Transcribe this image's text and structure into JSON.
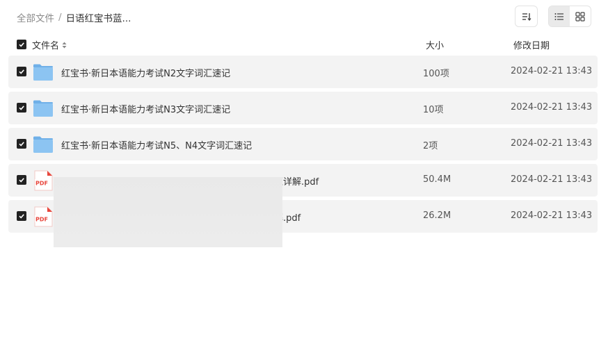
{
  "breadcrumb": {
    "root": "全部文件",
    "separator": "/",
    "current": "日语红宝书蓝..."
  },
  "toolbar": {
    "sort_icon": "sort-icon",
    "list_view_icon": "list-view-icon",
    "grid_view_icon": "grid-view-icon",
    "active_view": "list"
  },
  "table": {
    "headers": {
      "name": "文件名",
      "size": "大小",
      "date": "修改日期"
    },
    "rows": [
      {
        "type": "folder",
        "checked": true,
        "name": "红宝书·新日本语能力考试N2文字词汇速记",
        "size": "100项",
        "date": "2024-02-21 13:43"
      },
      {
        "type": "folder",
        "checked": true,
        "name": "红宝书·新日本语能力考试N3文字词汇速记",
        "size": "10项",
        "date": "2024-02-21 13:43"
      },
      {
        "type": "folder",
        "checked": true,
        "name": "红宝书·新日本语能力考试N5、N4文字词汇速记",
        "size": "2项",
        "date": "2024-02-21 13:43"
      },
      {
        "type": "pdf",
        "checked": true,
        "name": "汇详解.pdf",
        "size": "50.4M",
        "date": "2024-02-21 13:43"
      },
      {
        "type": "pdf",
        "checked": true,
        "name": "解.pdf",
        "size": "26.2M",
        "date": "2024-02-21 13:43"
      }
    ]
  },
  "colors": {
    "row_bg": "#f3f3f3",
    "checkbox": "#222222",
    "folder": "#8cc4f2",
    "pdf": "#e8463c"
  }
}
